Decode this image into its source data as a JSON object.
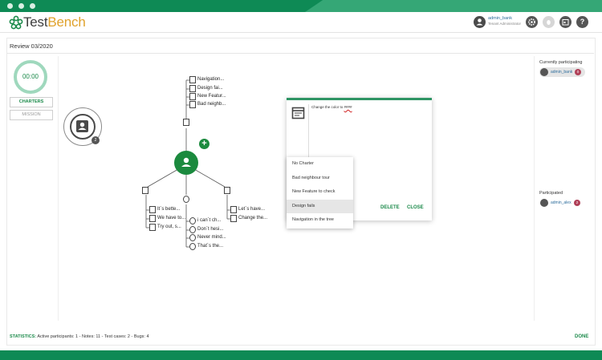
{
  "app": {
    "logo_test": "Test",
    "logo_bench": "Bench",
    "user_name": "admin_bank",
    "user_role": "Tenant Administrator"
  },
  "header_icons": [
    "gear-icon",
    "bug-icon",
    "calendar-icon",
    "help-icon"
  ],
  "page": {
    "title": "Review 03/2020"
  },
  "left": {
    "timer": "00:00",
    "charters_label": "CHARTERS",
    "mission_label": "MISSION"
  },
  "bubble": {
    "count": "2"
  },
  "mindmap": {
    "top_items": [
      "Navigation...",
      "Design fai...",
      "New Featur...",
      "Bad neighb..."
    ],
    "notes_items": [
      "It´s bette...",
      "We have to...",
      "Try out, s..."
    ],
    "bugs_items": [
      "i can´t ch...",
      "Don´t hesi...",
      "Never mind...",
      "That´s the..."
    ],
    "tests_items": [
      "Let´s have...",
      "Change the..."
    ],
    "center_badge": "A",
    "add_symbol": "+"
  },
  "dialog": {
    "text_before": "Change the color to ",
    "text_err": "#### ",
    "delete_label": "DELETE",
    "close_label": "CLOSE"
  },
  "menu": {
    "items": [
      "No Charter",
      "Bad neighbour tour",
      "New Feature to check",
      "Design fails",
      "Navigation in the tree"
    ],
    "active_index": 3
  },
  "sidebar": {
    "current_title": "Currently participating",
    "current_user": "admin_bank",
    "current_count": "0",
    "participated_title": "Participated",
    "participated_user": "admin_alex",
    "participated_count": "2"
  },
  "footer": {
    "stats_label": "STATISTICS:",
    "stats_text": " Active participants: 1 - Notes: 11 - Test cases: 2 - Bugs: 4",
    "done_label": "DONE"
  },
  "colors": {
    "primary_green": "#1b8a4a",
    "titlebar_green": "#0e8a55",
    "logo_orange": "#e0a22c",
    "badge_red": "#b04058"
  }
}
